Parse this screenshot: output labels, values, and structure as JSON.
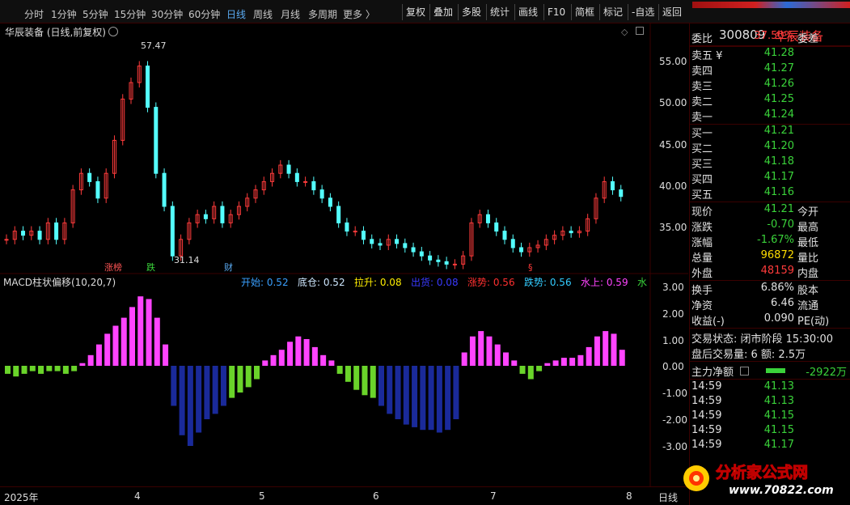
{
  "periods": [
    "分时",
    "1分钟",
    "5分钟",
    "15分钟",
    "30分钟",
    "60分钟",
    "日线",
    "周线",
    "月线",
    "多周期",
    "更多 〉"
  ],
  "active_period": "日线",
  "toolbar": [
    "复权",
    "叠加",
    "多股",
    "统计",
    "画线",
    "F10",
    "简框",
    "标记",
    "-自选",
    "返回"
  ],
  "chart": {
    "title": "华辰装备 (日线,前复权)",
    "high_label": "57.47",
    "low_label": "31.14",
    "y_ticks": [
      "55.00",
      "50.00",
      "45.00",
      "40.00",
      "35.00"
    ],
    "tags": [
      "涨榜",
      "跌",
      "财",
      "§"
    ]
  },
  "indicator": {
    "name": "MACD柱状偏移(10,20,7)",
    "items": [
      {
        "label": "开始: 0.52",
        "color": "#3aa0ff"
      },
      {
        "label": "底仓: 0.52",
        "color": "#cfe8ff"
      },
      {
        "label": "拉升: 0.08",
        "color": "#ffee00"
      },
      {
        "label": "出货: 0.08",
        "color": "#3a3aff"
      },
      {
        "label": "涨势: 0.56",
        "color": "#ff3030"
      },
      {
        "label": "跌势: 0.56",
        "color": "#33ccff"
      },
      {
        "label": "水上: 0.59",
        "color": "#ff44ff"
      },
      {
        "label": "水",
        "color": "#3ad23a"
      }
    ],
    "y_ticks": [
      "3.00",
      "2.00",
      "1.00",
      "0.00",
      "-1.00",
      "-2.00",
      "-3.00"
    ]
  },
  "dates": [
    "2025年",
    "4",
    "5",
    "6",
    "7",
    "8"
  ],
  "period_label": "日线",
  "stock": {
    "code": "300809",
    "name": "华辰装备"
  },
  "weibi": {
    "label": "委比",
    "value": "37.50%",
    "right": "委差"
  },
  "asks": [
    {
      "label": "卖五 ¥",
      "price": "41.28"
    },
    {
      "label": "卖四",
      "price": "41.27"
    },
    {
      "label": "卖三",
      "price": "41.26"
    },
    {
      "label": "卖二",
      "price": "41.25"
    },
    {
      "label": "卖一",
      "price": "41.24"
    }
  ],
  "bids": [
    {
      "label": "买一",
      "price": "41.21"
    },
    {
      "label": "买二",
      "price": "41.20"
    },
    {
      "label": "买三",
      "price": "41.18"
    },
    {
      "label": "买四",
      "price": "41.17"
    },
    {
      "label": "买五",
      "price": "41.16"
    }
  ],
  "quote": [
    {
      "l": "现价",
      "v": "41.21",
      "r": "今开",
      "c": "g"
    },
    {
      "l": "涨跌",
      "v": "-0.70",
      "r": "最高",
      "c": "g"
    },
    {
      "l": "涨幅",
      "v": "-1.67%",
      "r": "最低",
      "c": "g"
    },
    {
      "l": "总量",
      "v": "96872",
      "r": "量比",
      "c": "y"
    },
    {
      "l": "外盘",
      "v": "48159",
      "r": "内盘",
      "c": "rd"
    }
  ],
  "fin": [
    {
      "l": "换手",
      "v": "6.86%",
      "r": "股本"
    },
    {
      "l": "净资",
      "v": "6.46",
      "r": "流通"
    },
    {
      "l": "收益(-)",
      "v": "0.090",
      "r": "PE(动)"
    }
  ],
  "status": {
    "l1": "交易状态: 闭市阶段 15:30:00",
    "l2": "盘后交易量: 6  额: 2.5万"
  },
  "flow": {
    "label": "主力净额",
    "value": "-2922万"
  },
  "ticks": [
    {
      "t": "14:59",
      "p": "41.13"
    },
    {
      "t": "14:59",
      "p": "41.13"
    },
    {
      "t": "14:59",
      "p": "41.15"
    },
    {
      "t": "14:59",
      "p": "41.15"
    },
    {
      "t": "14:59",
      "p": "41.17"
    }
  ],
  "watermark": {
    "text": "分析家公式网",
    "url": "www.70822.com"
  }
}
